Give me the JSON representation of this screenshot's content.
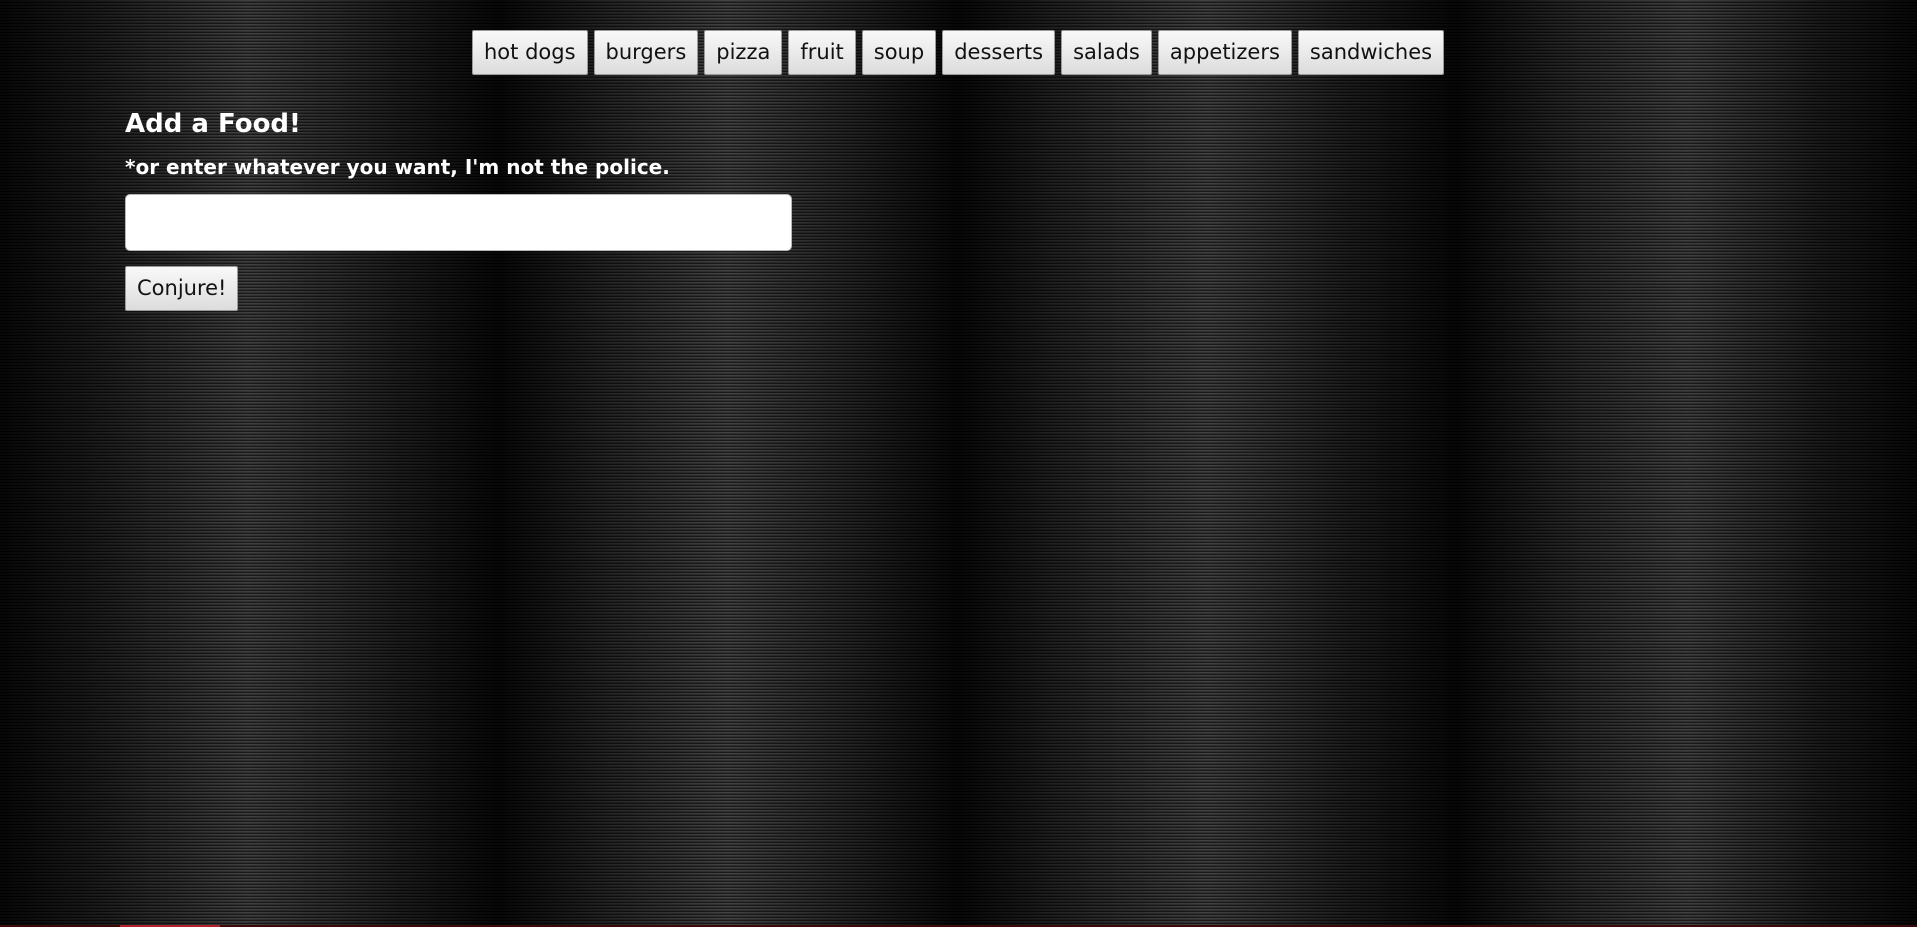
{
  "nav": {
    "items": [
      {
        "label": "hot dogs"
      },
      {
        "label": "burgers"
      },
      {
        "label": "pizza"
      },
      {
        "label": "fruit"
      },
      {
        "label": "soup"
      },
      {
        "label": "desserts"
      },
      {
        "label": "salads"
      },
      {
        "label": "appetizers"
      },
      {
        "label": "sandwiches"
      }
    ]
  },
  "form": {
    "title": "Add a Food!",
    "subtitle": "*or enter whatever you want, I'm not the police.",
    "input_value": "",
    "submit_label": "Conjure!"
  },
  "colors": {
    "background": "#000000",
    "text": "#ffffff",
    "button_bg": "#e8e8e8",
    "bottom_accent": "#b3202a"
  }
}
